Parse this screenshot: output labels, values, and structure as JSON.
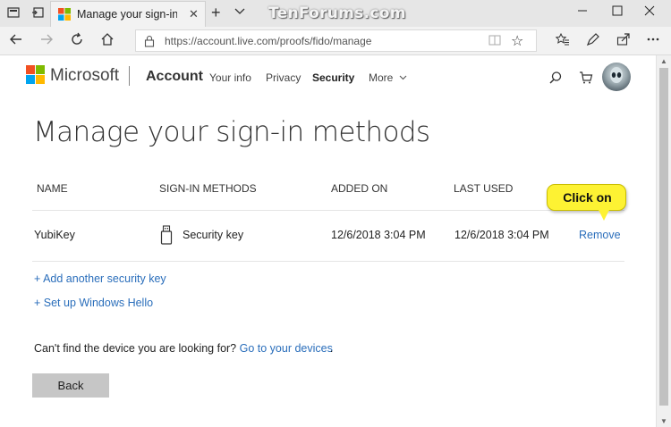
{
  "browser": {
    "tab_title": "Manage your sign-in me",
    "url": "https://account.live.com/proofs/fido/manage",
    "watermark": "TenForums.com",
    "icons": [
      "tab-preview-icon",
      "set-aside-tabs-icon",
      "close-icon",
      "new-tab-icon",
      "tab-list-chevron-icon",
      "minimize-icon",
      "maximize-icon",
      "close-window-icon",
      "back-icon",
      "forward-icon",
      "refresh-icon",
      "home-icon",
      "lock-icon",
      "reading-view-icon",
      "star-icon",
      "favorites-icon",
      "pen-icon",
      "share-icon",
      "more-icon"
    ]
  },
  "header": {
    "brand": "Microsoft",
    "section": "Account",
    "nav": {
      "your_info": "Your info",
      "privacy": "Privacy",
      "security": "Security",
      "more": "More"
    }
  },
  "main": {
    "title": "Manage your sign-in methods",
    "columns": {
      "name": "NAME",
      "methods": "SIGN-IN METHODS",
      "added": "ADDED ON",
      "last_used": "LAST USED"
    },
    "rows": [
      {
        "name": "YubiKey",
        "method": "Security key",
        "added_on": "12/6/2018 3:04 PM",
        "last_used": "12/6/2018 3:04 PM",
        "action": "Remove"
      }
    ],
    "add_key_link": "+ Add another security key",
    "hello_link": "+ Set up Windows Hello",
    "cant_find_text": "Can't find the device you are looking for?",
    "devices_link": "Go to your devices",
    "devices_period": ".",
    "back_button": "Back"
  },
  "annotation": {
    "callout": "Click on"
  },
  "colors": {
    "link": "#2a6ebb",
    "callout": "#fdf233",
    "ms_red": "#f25022",
    "ms_green": "#7fba00",
    "ms_blue": "#00a4ef",
    "ms_yellow": "#ffb900"
  }
}
